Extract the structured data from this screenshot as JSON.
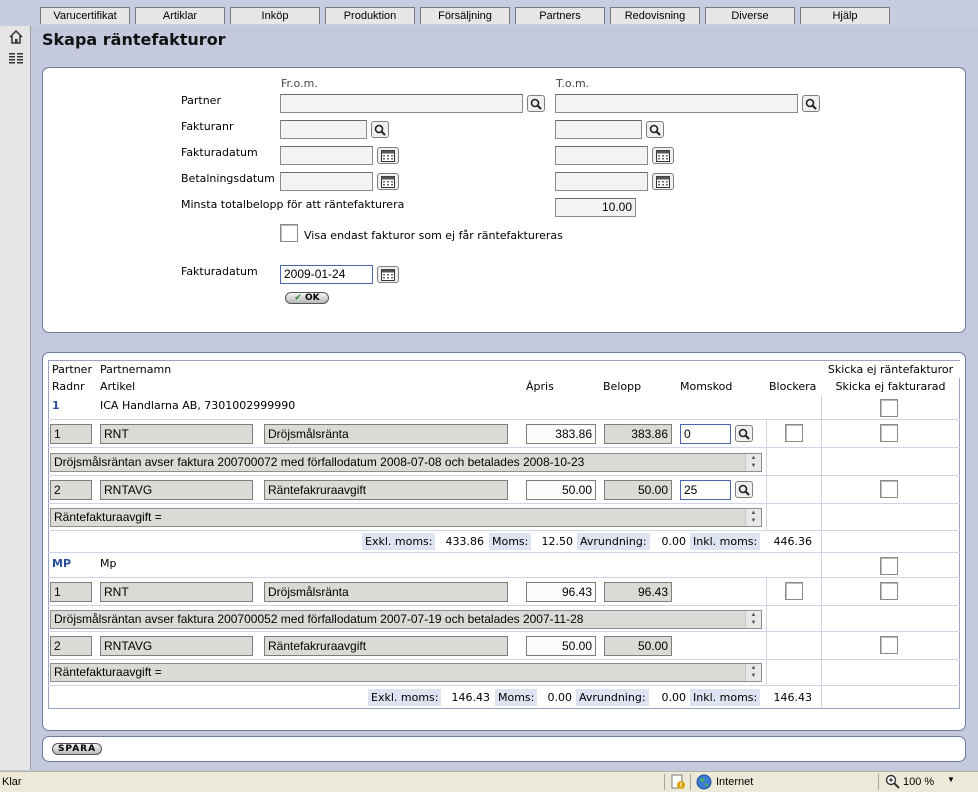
{
  "menu_tabs": [
    "Varucertifikat",
    "Artiklar",
    "Inköp",
    "Produktion",
    "Försäljning",
    "Partners",
    "Redovisning",
    "Diverse",
    "Hjälp"
  ],
  "left_icons": [
    "home-icon",
    "list-icon"
  ],
  "page_title": "Skapa räntefakturor",
  "filter": {
    "from_header": "Fr.o.m.",
    "to_header": "T.o.m.",
    "partner_label": "Partner",
    "partner_from": "",
    "partner_to": "",
    "invoice_no_label": "Fakturanr",
    "invoice_no_from": "",
    "invoice_no_to": "",
    "invoice_date_label": "Fakturadatum",
    "invoice_date_from": "",
    "invoice_date_to": "",
    "payment_date_label": "Betalningsdatum",
    "payment_date_from": "",
    "payment_date_to": "",
    "min_total_label": "Minsta totalbelopp för att räntefakturera",
    "min_total_value": "10.00",
    "only_not_invoiceable_label": "Visa endast fakturor som ej får räntefaktureras",
    "only_not_invoiceable_checked": false,
    "new_invoice_date_label": "Fakturadatum",
    "new_invoice_date": "2009-01-24",
    "ok_label": "OK"
  },
  "grid": {
    "headers": {
      "partner": "Partner",
      "partner_name": "Partnernamn",
      "dont_send": "Skicka ej räntefakturor",
      "row_no": "Radnr",
      "article": "Artikel",
      "unit_price": "Ápris",
      "amount": "Belopp",
      "vat_code": "Momskod",
      "block": "Blockera",
      "dont_invoice_row": "Skicka ej fakturarad"
    },
    "partners": [
      {
        "code": "1",
        "name": "ICA Handlarna AB, 7301002999990",
        "rows": [
          {
            "row_no": "1",
            "article": "RNT",
            "description": "Dröjsmålsränta",
            "unit_price": "383.86",
            "amount": "383.86",
            "vat_code": "0",
            "text": "Dröjsmålsräntan avser faktura 200700072 med förfallodatum 2008-07-08 och betalades 2008-10-23"
          },
          {
            "row_no": "2",
            "article": "RNTAVG",
            "description": "Räntefakruraavgift",
            "unit_price": "50.00",
            "amount": "50.00",
            "vat_code": "25",
            "text": "Räntefakturaavgift ="
          }
        ],
        "totals": {
          "excl_label": "Exkl. moms:",
          "excl": "433.86",
          "vat_label": "Moms:",
          "vat": "12.50",
          "round_label": "Avrundning:",
          "round": "0.00",
          "incl_label": "Inkl. moms:",
          "incl": "446.36"
        }
      },
      {
        "code": "MP",
        "name": "Mp",
        "rows": [
          {
            "row_no": "1",
            "article": "RNT",
            "description": "Dröjsmålsränta",
            "unit_price": "96.43",
            "amount": "96.43",
            "vat_code": "",
            "text": "Dröjsmålsräntan avser faktura 200700052 med förfallodatum 2007-07-19 och betalades 2007-11-28"
          },
          {
            "row_no": "2",
            "article": "RNTAVG",
            "description": "Räntefakruraavgift",
            "unit_price": "50.00",
            "amount": "50.00",
            "vat_code": "",
            "text": "Räntefakturaavgift ="
          }
        ],
        "totals": {
          "excl_label": "Exkl. moms:",
          "excl": "146.43",
          "vat_label": "Moms:",
          "vat": "0.00",
          "round_label": "Avrundning:",
          "round": "0.00",
          "incl_label": "Inkl. moms:",
          "incl": "146.43"
        }
      }
    ]
  },
  "save_label": "SPARA",
  "statusbar": {
    "status": "Klar",
    "zone": "Internet",
    "zoom": "100 %"
  }
}
